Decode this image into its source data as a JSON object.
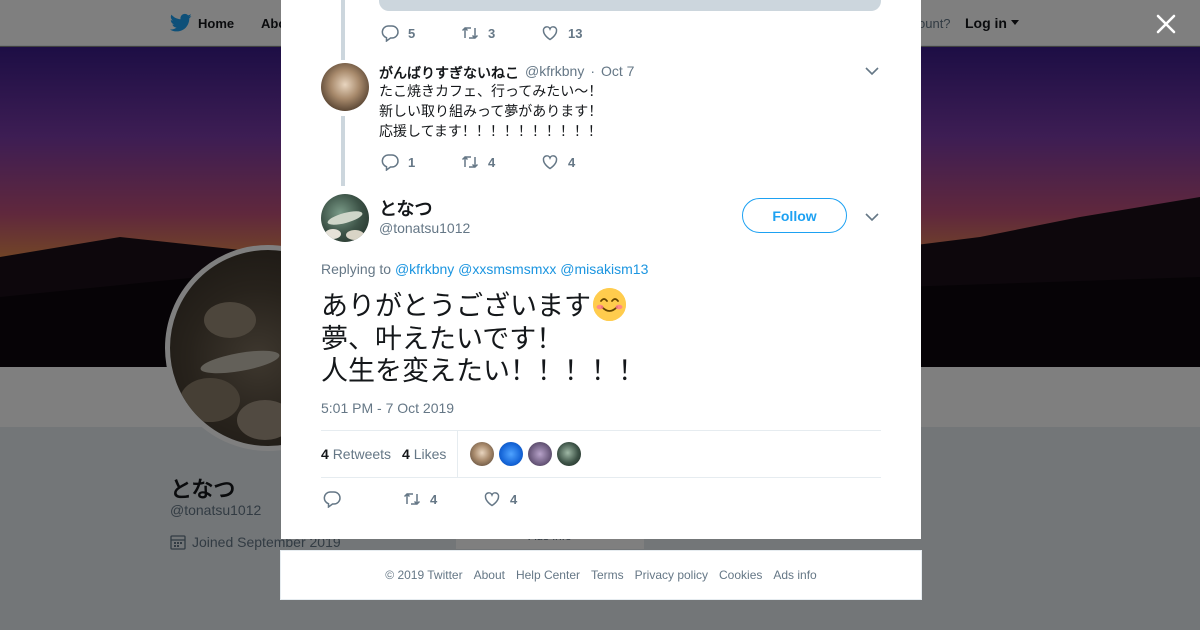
{
  "background_page": {
    "nav": {
      "home_label": "Home",
      "about_label": "Abo",
      "account_text": "ccount?",
      "login_label": "Log in"
    },
    "profile": {
      "name": "となつ",
      "handle": "@tonatsu1012",
      "joined": "Joined September 2019"
    },
    "ads_remnant": "Ads info"
  },
  "prev_tweet_actions": {
    "replies": "5",
    "retweets": "3",
    "likes": "13"
  },
  "reply_tweet": {
    "name": "がんばりすぎないねこ",
    "handle": "@kfrkbny",
    "separator": "·",
    "date": "Oct 7",
    "lines": [
      "たこ焼きカフェ、行ってみたい〜！",
      "新しい取り組みって夢があります！",
      "応援してます！！！！！！！！！！"
    ],
    "replies": "1",
    "retweets": "4",
    "likes": "4"
  },
  "main_tweet": {
    "name": "となつ",
    "handle": "@tonatsu1012",
    "follow_label": "Follow",
    "replying_prefix": "Replying to",
    "mentions": [
      "@kfrkbny",
      "@xxsmsmsmxx",
      "@misakism13"
    ],
    "lines": [
      "ありがとうございます",
      "夢、叶えたいです！",
      "人生を変えたい！！！！！"
    ],
    "emoji_name": "smiling-face-with-smiling-eyes",
    "timestamp": "5:01 PM - 7 Oct 2019",
    "retweet_count": "4",
    "retweet_label": "Retweets",
    "like_count": "4",
    "like_label": "Likes",
    "actions": {
      "retweets": "4",
      "likes": "4"
    }
  },
  "footer": {
    "copyright": "© 2019 Twitter",
    "links": [
      "About",
      "Help Center",
      "Terms",
      "Privacy policy",
      "Cookies",
      "Ads info"
    ]
  },
  "colors": {
    "accent": "#1da1f2",
    "link": "#1b95e0",
    "muted": "#657786",
    "text": "#14171a",
    "border": "#e6ecf0",
    "thread": "#ccd6dd"
  }
}
